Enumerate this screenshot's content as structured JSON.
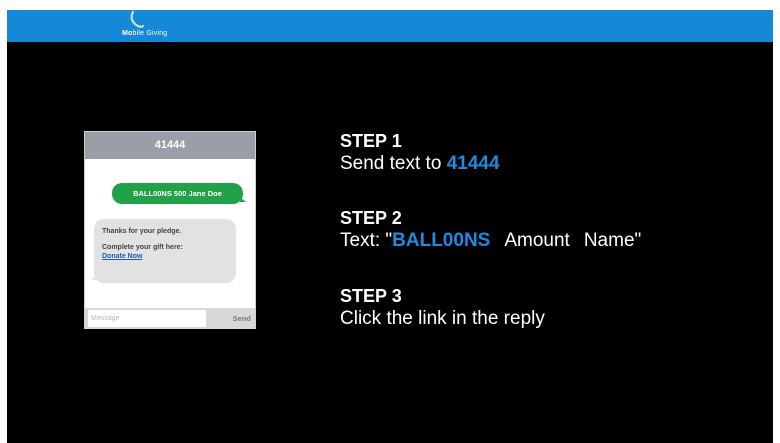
{
  "header": {
    "logo_bold": "Mo",
    "logo_light": "bile Giving",
    "logo_icon": "phone-swoosh-icon"
  },
  "phone": {
    "number": "41444",
    "outgoing_message": "BALL00NS 500 Jane Doe",
    "reply_line1": "Thanks for your pledge.",
    "reply_line2": "Complete your gift here:",
    "reply_link": "Donate Now",
    "input_placeholder": "Message",
    "send_label": "Send"
  },
  "steps": [
    {
      "title": "STEP 1",
      "text_prefix": "Send text to ",
      "text_accent": "41444"
    },
    {
      "title": "STEP 2",
      "text_prefix": "Text: \"",
      "text_accent": "BALL00NS",
      "word_amount": "Amount",
      "word_name": "Name\""
    },
    {
      "title": "STEP 3",
      "text": "Click the link in the reply"
    }
  ],
  "colors": {
    "topbar": "#1688d8",
    "background": "#000000",
    "accent": "#1f8be0",
    "outgoing_bubble": "#21a14a",
    "incoming_bubble": "#e2e2e2",
    "phone_header": "#9a9fa7"
  }
}
